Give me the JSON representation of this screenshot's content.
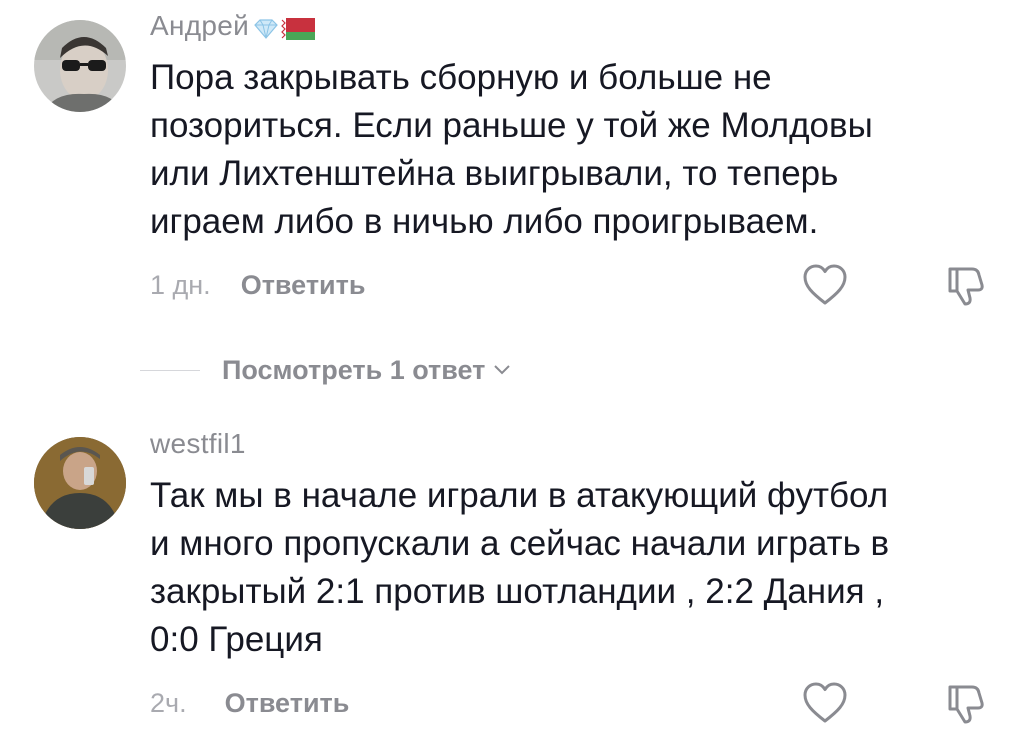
{
  "comments": [
    {
      "username": "Андрей",
      "text": "Пора закрывать сборную и больше не\nпозориться. Если раньше у той же Молдовы\nили Лихтенштейна выигрывали, то теперь\nиграем либо в ничью либо проигрываем.",
      "time": "1 дн.",
      "reply_label": "Ответить",
      "badges": [
        "diamond-icon",
        "belarus-flag-icon"
      ]
    },
    {
      "username": "westfil1",
      "text": "Так мы в начале играли в атакующий футбол\nи много пропускали а сейчас начали играть в\nзакрытый 2:1 против шотландии , 2:2 Дания ,\n0:0 Греция",
      "time": "2ч.",
      "reply_label": "Ответить"
    }
  ],
  "view_replies_label": "Посмотреть 1 ответ",
  "colors": {
    "text": "#161823",
    "secondary": "#8a8b91",
    "muted": "#a9aab0",
    "divider": "#d6d7db",
    "flag_red": "#c8313e",
    "flag_green": "#4aa657",
    "diamond": "#9fd0ef"
  }
}
